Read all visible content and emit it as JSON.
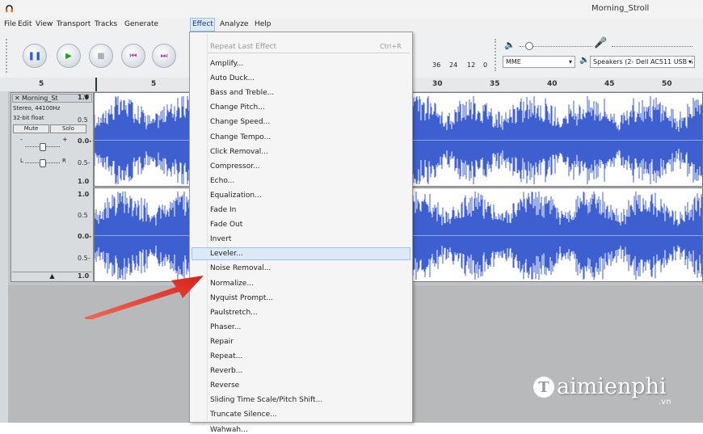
{
  "window": {
    "title": "Morning_Stroll"
  },
  "menubar": {
    "items": [
      "File",
      "Edit",
      "View",
      "Transport",
      "Tracks",
      "Generate",
      "Effect",
      "Analyze",
      "Help"
    ],
    "active": "Effect"
  },
  "transport": {
    "buttons": [
      {
        "name": "pause",
        "glyph": "❚❚",
        "color": "#2c5ed6"
      },
      {
        "name": "play",
        "glyph": "▶",
        "color": "#1aa31a"
      },
      {
        "name": "stop",
        "glyph": "■",
        "color": "#b0b0b0"
      },
      {
        "name": "skip-start",
        "glyph": "⏮",
        "color": "#b03aa6"
      },
      {
        "name": "skip-end",
        "glyph": "⏭",
        "color": "#b03aa6"
      }
    ]
  },
  "meter": {
    "ticks": [
      "36",
      "24",
      "12",
      "0"
    ]
  },
  "devices": {
    "host": "MME",
    "output": "Speakers (2- Dell AC511 USB S"
  },
  "ruler": {
    "ticks": [
      "5",
      "5",
      "30",
      "35",
      "40",
      "45",
      "50"
    ]
  },
  "track": {
    "name": "Morning_St",
    "info_rate": "Stereo, 44100Hz",
    "info_format": "32-bit float",
    "mute": "Mute",
    "solo": "Solo",
    "gain_minus": "-",
    "gain_plus": "+",
    "pan_left": "L",
    "pan_right": "R",
    "collapse": "▲",
    "scale": [
      "1.0",
      "0.5",
      "0.0-",
      "0.5-",
      "1.0"
    ]
  },
  "effect_menu": {
    "header": "Repeat Last Effect",
    "header_shortcut": "Ctrl+R",
    "items": [
      "Amplify...",
      "Auto Duck...",
      "Bass and Treble...",
      "Change Pitch...",
      "Change Speed...",
      "Change Tempo...",
      "Click Removal...",
      "Compressor...",
      "Echo...",
      "Equalization...",
      "Fade In",
      "Fade Out",
      "Invert",
      "Leveler...",
      "Noise Removal...",
      "Normalize...",
      "Nyquist Prompt...",
      "Paulstretch...",
      "Phaser...",
      "Repair",
      "Repeat...",
      "Reverb...",
      "Reverse",
      "Sliding Time Scale/Pitch Shift...",
      "Truncate Silence...",
      "Wahwah..."
    ],
    "highlighted": "Leveler..."
  },
  "watermark": {
    "text": "aimienphi",
    "sub": ".vn"
  },
  "colors": {
    "wave": "#3d5fd0",
    "arrow": "#e8302a",
    "highlight": "#dce9f6"
  }
}
